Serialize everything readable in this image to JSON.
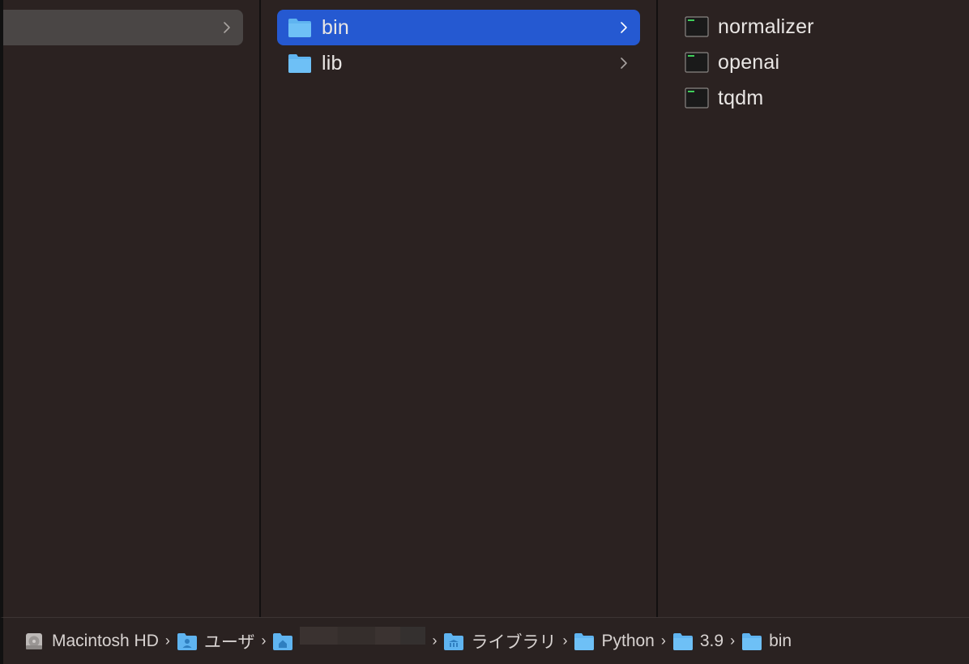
{
  "column1": {
    "selected_item_label": ""
  },
  "column2": {
    "items": [
      {
        "label": "bin",
        "selected": true,
        "icon": "folder-icon"
      },
      {
        "label": "lib",
        "selected": false,
        "icon": "folder-icon"
      }
    ]
  },
  "column3": {
    "items": [
      {
        "label": "normalizer",
        "icon": "terminal-exec-icon"
      },
      {
        "label": "openai",
        "icon": "terminal-exec-icon"
      },
      {
        "label": "tqdm",
        "icon": "terminal-exec-icon"
      }
    ]
  },
  "pathbar": {
    "crumbs": [
      {
        "label": "Macintosh HD",
        "icon": "hard-drive-icon"
      },
      {
        "label": "ユーザ",
        "icon": "users-folder-icon"
      },
      {
        "label": "",
        "icon": "home-folder-icon",
        "redacted": true
      },
      {
        "label": "ライブラリ",
        "icon": "library-folder-icon"
      },
      {
        "label": "Python",
        "icon": "folder-icon"
      },
      {
        "label": "3.9",
        "icon": "folder-icon"
      },
      {
        "label": "bin",
        "icon": "folder-icon"
      }
    ],
    "separator": "›"
  },
  "colors": {
    "background": "#2a2120",
    "selection": "#2559d1",
    "parent_selection": "#4a4645",
    "folder_blue": "#5fb4f0"
  }
}
